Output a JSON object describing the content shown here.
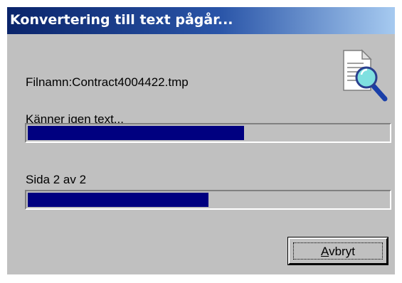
{
  "window": {
    "title": "Konvertering till text pågår..."
  },
  "file": {
    "label": "Filnamn:",
    "name": "Contract4004422.tmp",
    "display": "Filnamn:Contract4004422.tmp"
  },
  "recognition": {
    "status_text": "Känner igen text...",
    "progress_fraction": 0.6
  },
  "pages": {
    "status_text": "Sida 2 av 2",
    "current": 2,
    "total": 2,
    "progress_fraction": 0.5
  },
  "cancel_button": {
    "label": "Avbryt",
    "accelerator": "A",
    "label_rest": "vbryt"
  },
  "icons": {
    "document_search": "document-magnifier-icon"
  },
  "colors": {
    "title_bar_start": "#0a246a",
    "title_bar_end": "#a6caf0",
    "dialog_background": "#c0c0c0",
    "progress_fill": "#000080"
  }
}
